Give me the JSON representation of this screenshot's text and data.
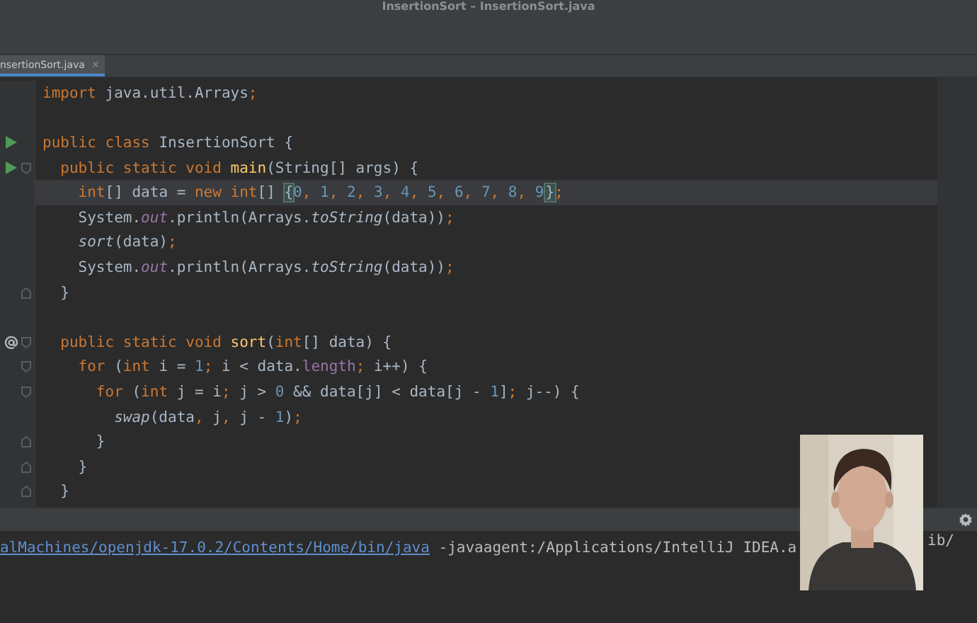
{
  "window": {
    "title": "InsertionSort – InsertionSort.java"
  },
  "tabs": [
    {
      "label": "nsertionSort.java",
      "selected": true
    }
  ],
  "editor": {
    "lines": [
      {
        "current": false,
        "tokens": [
          {
            "text": "import",
            "kind": "keyword"
          },
          {
            "text": " java.util.Arrays",
            "kind": "plain"
          },
          {
            "text": ";",
            "kind": "keyword"
          }
        ]
      },
      {
        "current": false,
        "blank_line_before": true,
        "run_marker": true,
        "tokens": [
          {
            "text": "public class ",
            "kind": "keyword"
          },
          {
            "text": "InsertionSort {",
            "kind": "plain"
          }
        ]
      },
      {
        "current": false,
        "run_marker": true,
        "fold_start": true,
        "tokens": [
          {
            "text": "  public static void ",
            "kind": "keyword"
          },
          {
            "text": "main",
            "kind": "declaration"
          },
          {
            "text": "(String[] args) {",
            "kind": "plain"
          }
        ]
      },
      {
        "current": true,
        "tokens": [
          {
            "text": "    int",
            "kind": "keyword"
          },
          {
            "text": "[] data = ",
            "kind": "plain"
          },
          {
            "text": "new int",
            "kind": "keyword"
          },
          {
            "text": "[] ",
            "kind": "plain"
          },
          {
            "text": "{",
            "kind": "brace"
          },
          {
            "text": "0",
            "kind": "number"
          },
          {
            "text": ", ",
            "kind": "keyword"
          },
          {
            "text": "1",
            "kind": "number"
          },
          {
            "text": ", ",
            "kind": "keyword"
          },
          {
            "text": "2",
            "kind": "number"
          },
          {
            "text": ", ",
            "kind": "keyword"
          },
          {
            "text": "3",
            "kind": "number"
          },
          {
            "text": ", ",
            "kind": "keyword"
          },
          {
            "text": "4",
            "kind": "number"
          },
          {
            "text": ", ",
            "kind": "keyword"
          },
          {
            "text": "5",
            "kind": "number"
          },
          {
            "text": ", ",
            "kind": "keyword"
          },
          {
            "text": "6",
            "kind": "number"
          },
          {
            "text": ", ",
            "kind": "keyword"
          },
          {
            "text": "7",
            "kind": "number"
          },
          {
            "text": ", ",
            "kind": "keyword"
          },
          {
            "text": "8",
            "kind": "number"
          },
          {
            "text": ", ",
            "kind": "keyword"
          },
          {
            "text": "9",
            "kind": "number",
            "caret": true
          },
          {
            "text": "}",
            "kind": "brace"
          },
          {
            "text": ";",
            "kind": "keyword"
          }
        ]
      },
      {
        "current": false,
        "tokens": [
          {
            "text": "    System.",
            "kind": "plain"
          },
          {
            "text": "out",
            "kind": "static-field"
          },
          {
            "text": ".println(Arrays.",
            "kind": "plain"
          },
          {
            "text": "toString",
            "kind": "static-call"
          },
          {
            "text": "(data))",
            "kind": "plain"
          },
          {
            "text": ";",
            "kind": "keyword"
          }
        ]
      },
      {
        "current": false,
        "tokens": [
          {
            "text": "    sort",
            "kind": "static-call"
          },
          {
            "text": "(data)",
            "kind": "plain"
          },
          {
            "text": ";",
            "kind": "keyword"
          }
        ]
      },
      {
        "current": false,
        "tokens": [
          {
            "text": "    System.",
            "kind": "plain"
          },
          {
            "text": "out",
            "kind": "static-field"
          },
          {
            "text": ".println(Arrays.",
            "kind": "plain"
          },
          {
            "text": "toString",
            "kind": "static-call"
          },
          {
            "text": "(data))",
            "kind": "plain"
          },
          {
            "text": ";",
            "kind": "keyword"
          }
        ]
      },
      {
        "current": false,
        "fold_end": true,
        "tokens": [
          {
            "text": "  }",
            "kind": "plain"
          }
        ]
      },
      {
        "current": false,
        "blank_line_before": true,
        "override_marker": true,
        "fold_start": true,
        "tokens": [
          {
            "text": "  public static void ",
            "kind": "keyword"
          },
          {
            "text": "sort",
            "kind": "declaration"
          },
          {
            "text": "(",
            "kind": "plain"
          },
          {
            "text": "int",
            "kind": "keyword"
          },
          {
            "text": "[] data) {",
            "kind": "plain"
          }
        ]
      },
      {
        "current": false,
        "fold_start": true,
        "tokens": [
          {
            "text": "    for ",
            "kind": "keyword"
          },
          {
            "text": "(",
            "kind": "plain"
          },
          {
            "text": "int ",
            "kind": "keyword"
          },
          {
            "text": "i = ",
            "kind": "plain"
          },
          {
            "text": "1",
            "kind": "number"
          },
          {
            "text": "; ",
            "kind": "keyword"
          },
          {
            "text": "i < data.",
            "kind": "plain"
          },
          {
            "text": "length",
            "kind": "field"
          },
          {
            "text": "; ",
            "kind": "keyword"
          },
          {
            "text": "i++) {",
            "kind": "plain"
          }
        ]
      },
      {
        "current": false,
        "fold_start": true,
        "tokens": [
          {
            "text": "      for ",
            "kind": "keyword"
          },
          {
            "text": "(",
            "kind": "plain"
          },
          {
            "text": "int ",
            "kind": "keyword"
          },
          {
            "text": "j = i",
            "kind": "plain"
          },
          {
            "text": "; ",
            "kind": "keyword"
          },
          {
            "text": "j > ",
            "kind": "plain"
          },
          {
            "text": "0",
            "kind": "number"
          },
          {
            "text": " && data[j] < data[j - ",
            "kind": "plain"
          },
          {
            "text": "1",
            "kind": "number"
          },
          {
            "text": "]",
            "kind": "plain"
          },
          {
            "text": "; ",
            "kind": "keyword"
          },
          {
            "text": "j--) {",
            "kind": "plain"
          }
        ]
      },
      {
        "current": false,
        "tokens": [
          {
            "text": "        swap",
            "kind": "static-call"
          },
          {
            "text": "(data",
            "kind": "plain"
          },
          {
            "text": ", ",
            "kind": "keyword"
          },
          {
            "text": "j",
            "kind": "plain"
          },
          {
            "text": ", ",
            "kind": "keyword"
          },
          {
            "text": "j - ",
            "kind": "plain"
          },
          {
            "text": "1",
            "kind": "number"
          },
          {
            "text": ")",
            "kind": "plain"
          },
          {
            "text": ";",
            "kind": "keyword"
          }
        ]
      },
      {
        "current": false,
        "fold_end": true,
        "tokens": [
          {
            "text": "      }",
            "kind": "plain"
          }
        ]
      },
      {
        "current": false,
        "fold_end": true,
        "tokens": [
          {
            "text": "    }",
            "kind": "plain"
          }
        ]
      },
      {
        "current": false,
        "fold_end": true,
        "tokens": [
          {
            "text": "  }",
            "kind": "plain"
          }
        ]
      }
    ]
  },
  "console": {
    "path_link": "alMachines/openjdk-17.0.2/Contents/Home/bin/java",
    "arguments": " -javaagent:/Applications/IntelliJ IDEA.a",
    "arguments_tail": "ib/"
  }
}
